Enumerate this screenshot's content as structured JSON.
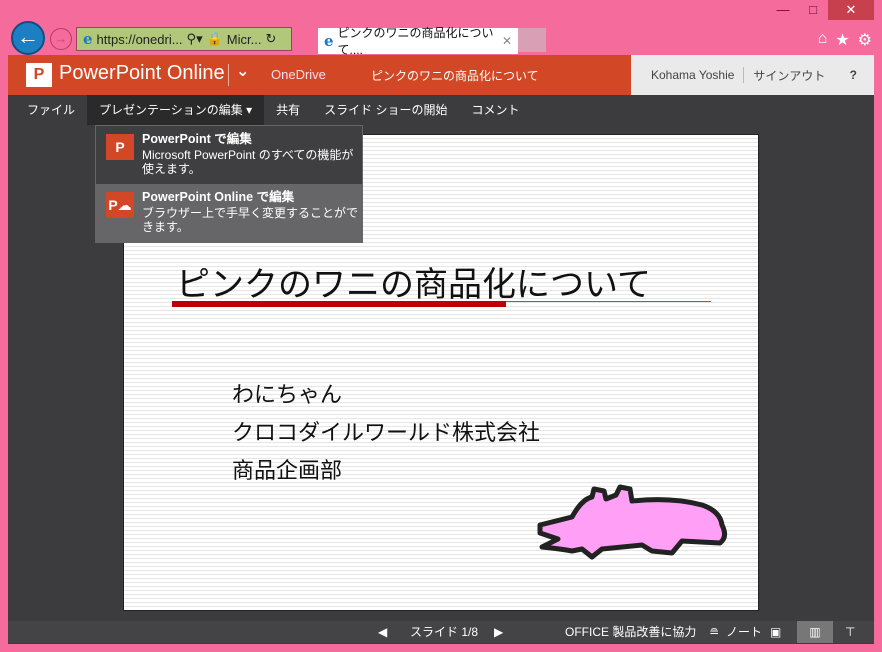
{
  "browser": {
    "window_controls": [
      "—",
      "□",
      "✕"
    ],
    "url": "https://onedri...",
    "site": "Micr...",
    "tab_title": "ピンクのワニの商品化について....",
    "icons": [
      "home-icon",
      "star-icon",
      "gear-icon"
    ]
  },
  "header": {
    "app_title": "PowerPoint Online",
    "onedrive": "OneDrive",
    "doc_title": "ピンクのワニの商品化について",
    "user": "Kohama Yoshie",
    "signout": "サインアウト",
    "help": "?"
  },
  "menu": {
    "items": [
      "ファイル",
      "プレゼンテーションの編集 ▾",
      "共有",
      "スライド ショーの開始",
      "コメント"
    ]
  },
  "dropdown": [
    {
      "title": "PowerPoint で編集",
      "desc": "Microsoft PowerPoint のすべての機能が使えます。"
    },
    {
      "title": "PowerPoint Online で編集",
      "desc": "ブラウザー上で手早く変更することができます。"
    }
  ],
  "slide": {
    "title": "ピンクのワニの商品化について",
    "lines": [
      "わにちゃん",
      "クロコダイルワールド株式会社",
      "商品企画部"
    ]
  },
  "status": {
    "slide": "スライド 1/8",
    "feedback": "OFFICE 製品改善に協力",
    "notes": "ノート"
  },
  "colors": {
    "brand": "#d24726",
    "frame": "#f56c9c",
    "croc": "#ff9ff5"
  }
}
